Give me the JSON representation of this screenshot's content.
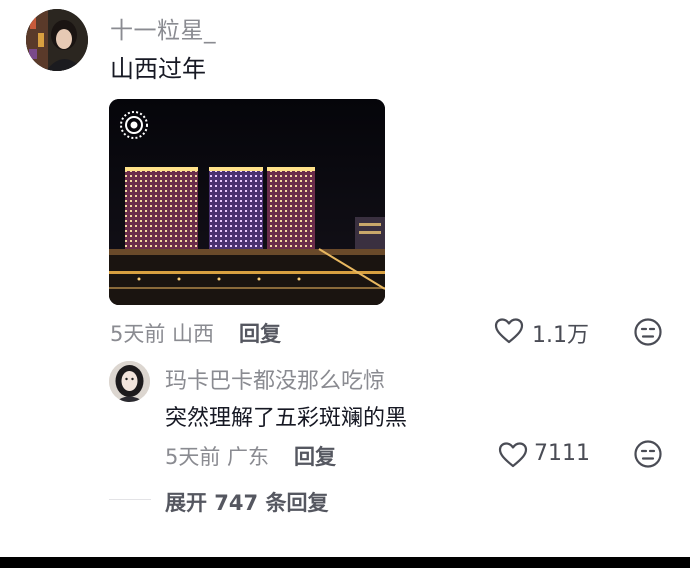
{
  "comment": {
    "username": "十一粒星_",
    "text": "山西过年",
    "meta": "5天前 山西",
    "reply_label": "回复",
    "likes": "1.1万",
    "image_icon": "live-photo-icon"
  },
  "reply": {
    "username": "玛卡巴卡都没那么吃惊",
    "text": "突然理解了五彩斑斓的黑",
    "meta": "5天前 广东",
    "reply_label": "回复",
    "likes": "7111"
  },
  "expand": {
    "label": "展开 747 条回复"
  },
  "icons": {
    "like": "heart-outline-icon",
    "dislike": "meh-face-icon"
  },
  "colors": {
    "primary_text": "#161823",
    "secondary_text": "#8a8b91",
    "action_text": "#555760"
  }
}
